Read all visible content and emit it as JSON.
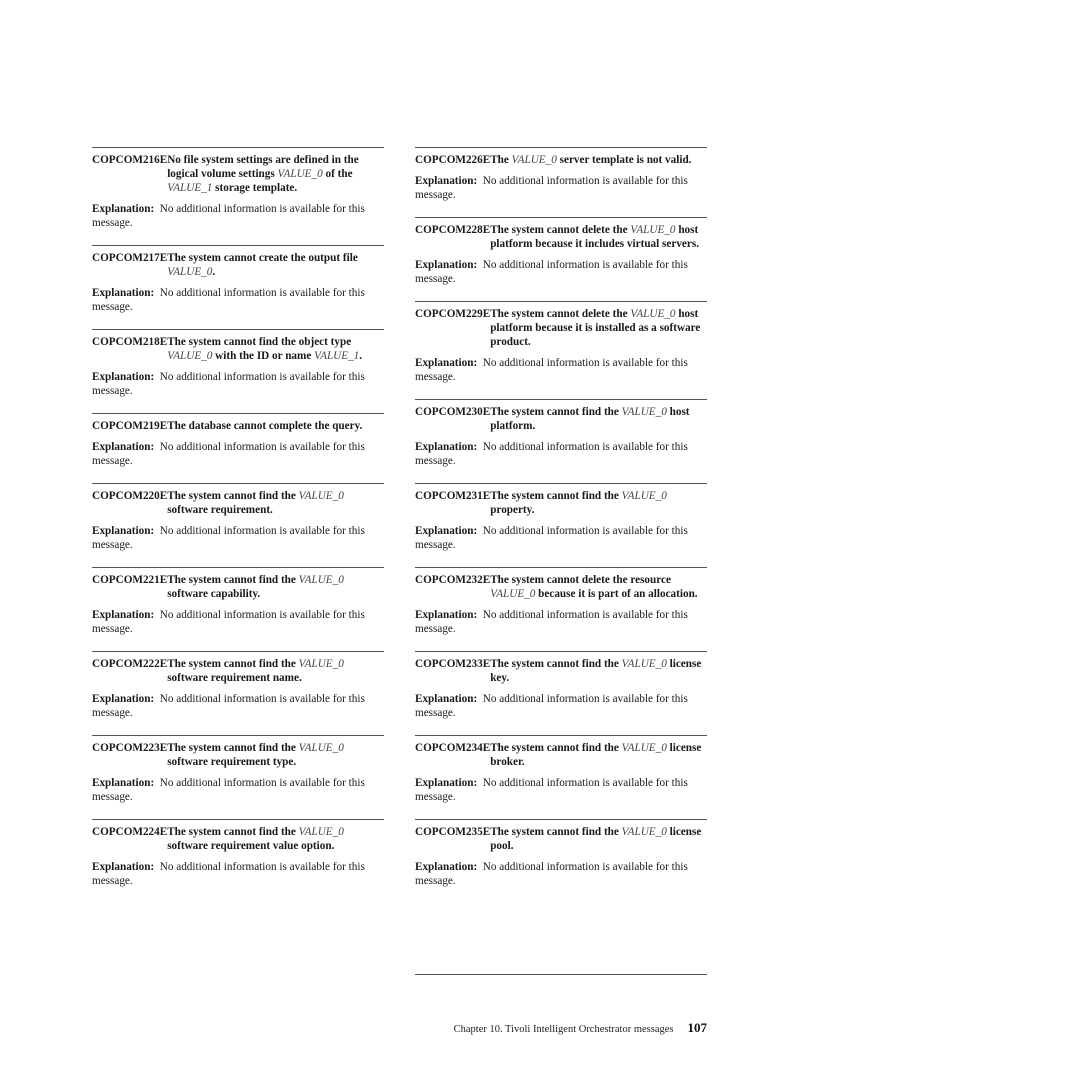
{
  "left_column": [
    {
      "code": "COPCOM216E",
      "message": [
        "No file system settings are defined in the logical volume settings ",
        {
          "v": "VALUE_0"
        },
        " of the ",
        {
          "v": "VALUE_1"
        },
        " storage template."
      ],
      "explanation_label": "Explanation:",
      "explanation": "No additional information is available for this message."
    },
    {
      "code": "COPCOM217E",
      "message": [
        "The system cannot create the output file ",
        {
          "v": "VALUE_0"
        },
        "."
      ],
      "explanation_label": "Explanation:",
      "explanation": "No additional information is available for this message."
    },
    {
      "code": "COPCOM218E",
      "message": [
        "The system cannot find the object type ",
        {
          "v": "VALUE_0"
        },
        " with the ID or name ",
        {
          "v": "VALUE_1"
        },
        "."
      ],
      "explanation_label": "Explanation:",
      "explanation": "No additional information is available for this message."
    },
    {
      "code": "COPCOM219E",
      "message": [
        "The database cannot complete the query."
      ],
      "explanation_label": "Explanation:",
      "explanation": "No additional information is available for this message."
    },
    {
      "code": "COPCOM220E",
      "message": [
        "The system cannot find the ",
        {
          "v": "VALUE_0"
        },
        " software requirement."
      ],
      "explanation_label": "Explanation:",
      "explanation": "No additional information is available for this message."
    },
    {
      "code": "COPCOM221E",
      "message": [
        "The system cannot find the ",
        {
          "v": "VALUE_0"
        },
        " software capability."
      ],
      "explanation_label": "Explanation:",
      "explanation": "No additional information is available for this message."
    },
    {
      "code": "COPCOM222E",
      "message": [
        "The system cannot find the ",
        {
          "v": "VALUE_0"
        },
        " software requirement name."
      ],
      "explanation_label": "Explanation:",
      "explanation": "No additional information is available for this message."
    },
    {
      "code": "COPCOM223E",
      "message": [
        "The system cannot find the ",
        {
          "v": "VALUE_0"
        },
        " software requirement type."
      ],
      "explanation_label": "Explanation:",
      "explanation": "No additional information is available for this message."
    },
    {
      "code": "COPCOM224E",
      "message": [
        "The system cannot find the ",
        {
          "v": "VALUE_0"
        },
        " software requirement value option."
      ],
      "explanation_label": "Explanation:",
      "explanation": "No additional information is available for this message."
    }
  ],
  "right_column": [
    {
      "code": "COPCOM226E",
      "message": [
        "The ",
        {
          "v": "VALUE_0"
        },
        " server template is not valid."
      ],
      "explanation_label": "Explanation:",
      "explanation": "No additional information is available for this message."
    },
    {
      "code": "COPCOM228E",
      "message": [
        "The system cannot delete the ",
        {
          "v": "VALUE_0"
        },
        " host platform because it includes virtual servers."
      ],
      "explanation_label": "Explanation:",
      "explanation": "No additional information is available for this message."
    },
    {
      "code": "COPCOM229E",
      "message": [
        "The system cannot delete the ",
        {
          "v": "VALUE_0"
        },
        " host platform because it is installed as a software product."
      ],
      "explanation_label": "Explanation:",
      "explanation": "No additional information is available for this message."
    },
    {
      "code": "COPCOM230E",
      "message": [
        "The system cannot find the ",
        {
          "v": "VALUE_0"
        },
        " host platform."
      ],
      "explanation_label": "Explanation:",
      "explanation": "No additional information is available for this message."
    },
    {
      "code": "COPCOM231E",
      "message": [
        "The system cannot find the ",
        {
          "v": "VALUE_0"
        },
        " property."
      ],
      "explanation_label": "Explanation:",
      "explanation": "No additional information is available for this message."
    },
    {
      "code": "COPCOM232E",
      "message": [
        "The system cannot delete the resource ",
        {
          "v": "VALUE_0"
        },
        " because it is part of an allocation."
      ],
      "explanation_label": "Explanation:",
      "explanation": "No additional information is available for this message."
    },
    {
      "code": "COPCOM233E",
      "message": [
        "The system cannot find the ",
        {
          "v": "VALUE_0"
        },
        " license key."
      ],
      "explanation_label": "Explanation:",
      "explanation": "No additional information is available for this message."
    },
    {
      "code": "COPCOM234E",
      "message": [
        "The system cannot find the ",
        {
          "v": "VALUE_0"
        },
        " license broker."
      ],
      "explanation_label": "Explanation:",
      "explanation": "No additional information is available for this message."
    },
    {
      "code": "COPCOM235E",
      "message": [
        "The system cannot find the ",
        {
          "v": "VALUE_0"
        },
        " license pool."
      ],
      "explanation_label": "Explanation:",
      "explanation": "No additional information is available for this message."
    }
  ],
  "footer": {
    "chapter": "Chapter 10. Tivoli Intelligent Orchestrator messages",
    "page_number": "107"
  }
}
